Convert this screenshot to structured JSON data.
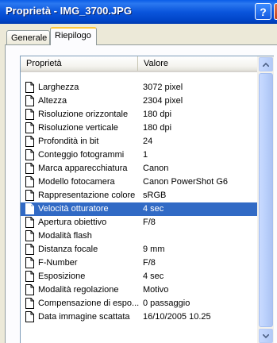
{
  "window": {
    "title": "Proprietà - IMG_3700.JPG",
    "help_label": "?",
    "close_label": "✕"
  },
  "tabs": [
    {
      "label": "Generale",
      "active": false
    },
    {
      "label": "Riepilogo",
      "active": true
    }
  ],
  "list": {
    "columns": {
      "property": "Proprietà",
      "value": "Valore"
    },
    "selected_index": 9,
    "rows": [
      {
        "name": "Larghezza",
        "value": "3072 pixel"
      },
      {
        "name": "Altezza",
        "value": "2304 pixel"
      },
      {
        "name": "Risoluzione orizzontale",
        "value": "180 dpi"
      },
      {
        "name": "Risoluzione verticale",
        "value": "180 dpi"
      },
      {
        "name": "Profondità in bit",
        "value": "24"
      },
      {
        "name": "Conteggio fotogrammi",
        "value": "1"
      },
      {
        "name": "Marca apparecchiatura",
        "value": "Canon"
      },
      {
        "name": "Modello fotocamera",
        "value": "Canon PowerShot G6"
      },
      {
        "name": "Rappresentazione colore",
        "value": "sRGB"
      },
      {
        "name": "Velocità otturatore",
        "value": "4 sec"
      },
      {
        "name": "Apertura obiettivo",
        "value": "F/8"
      },
      {
        "name": "Modalità flash",
        "value": ""
      },
      {
        "name": "Distanza focale",
        "value": "9 mm"
      },
      {
        "name": "F-Number",
        "value": "F/8"
      },
      {
        "name": "Esposizione",
        "value": "4 sec"
      },
      {
        "name": "Modalità regolazione",
        "value": "Motivo"
      },
      {
        "name": "Compensazione di espo...",
        "value": "0 passaggio"
      },
      {
        "name": "Data immagine scattata",
        "value": "16/10/2005 10.25"
      }
    ]
  },
  "colors": {
    "titlebar": "#0a55dc",
    "selection": "#316ac5",
    "active_tab_accent": "#ffc83c"
  }
}
